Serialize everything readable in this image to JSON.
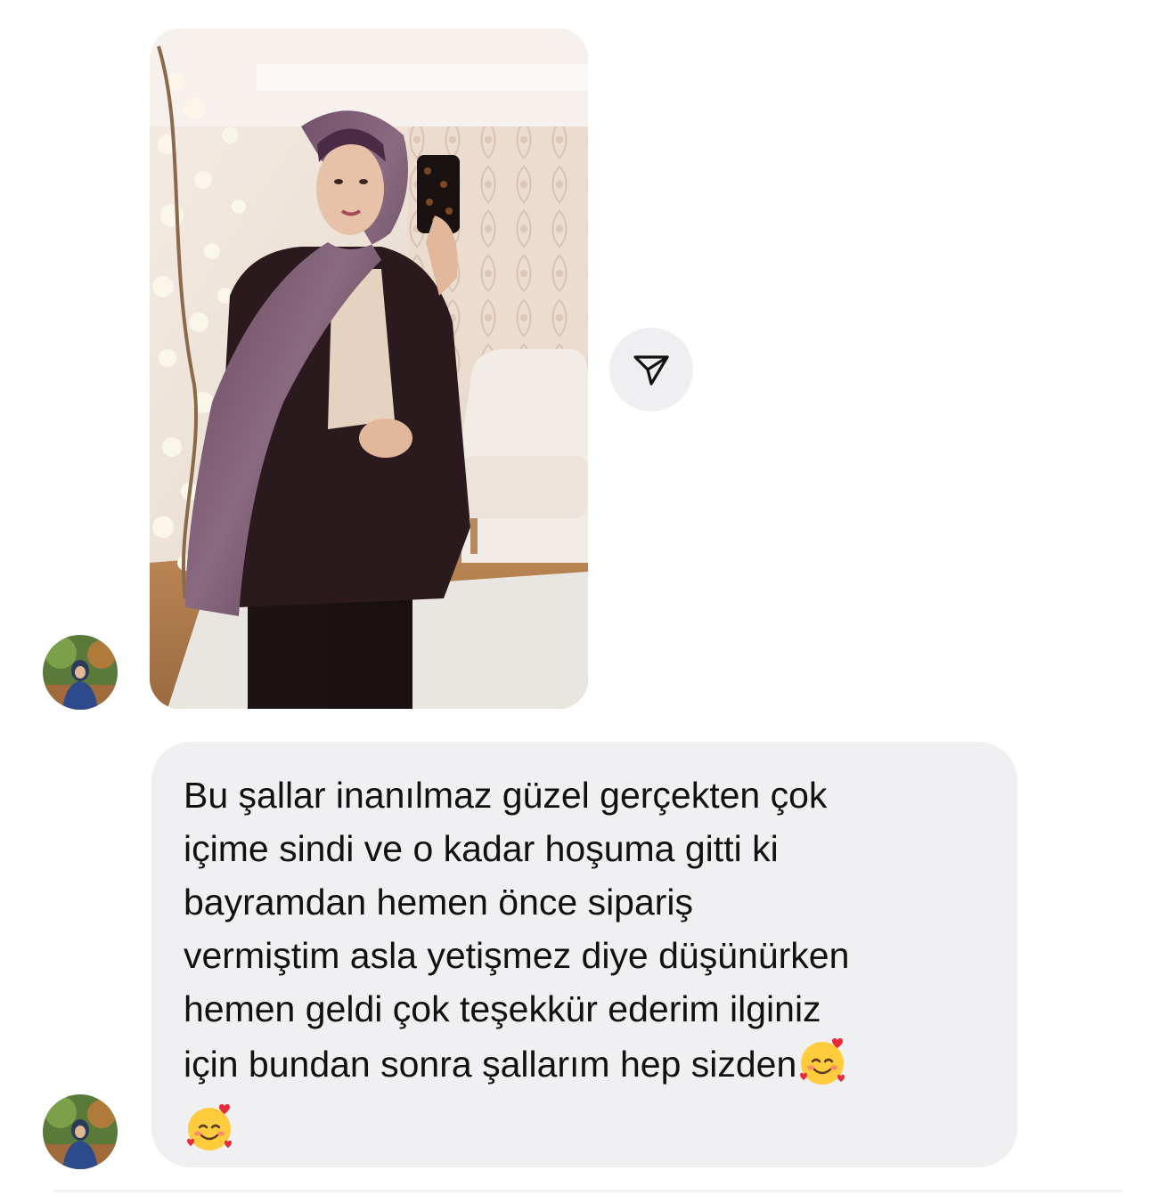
{
  "thread": {
    "photo_message": {
      "image_icon": "mirror-selfie-photo",
      "alt": ""
    },
    "share_button": {
      "icon": "paper-plane-icon"
    },
    "text_message": {
      "text": "Bu şallar inanılmaz güzel gerçekten çok\niçime sindi ve o kadar hoşuma gitti ki\nbayramdan hemen önce sipariş\nvermiştim asla yetişmez diye düşünürken\nhemen geldi çok teşekkür ederim ilginiz\niçin bundan sonra şallarım hep sizden",
      "emoji_icon": "smiling-face-with-hearts-icon",
      "emoji_count": 2
    },
    "avatar_icon": "profile-avatar"
  },
  "colors": {
    "bubble_background": "#f0f0f2",
    "share_button_background": "#efeff1",
    "text": "#111111"
  }
}
